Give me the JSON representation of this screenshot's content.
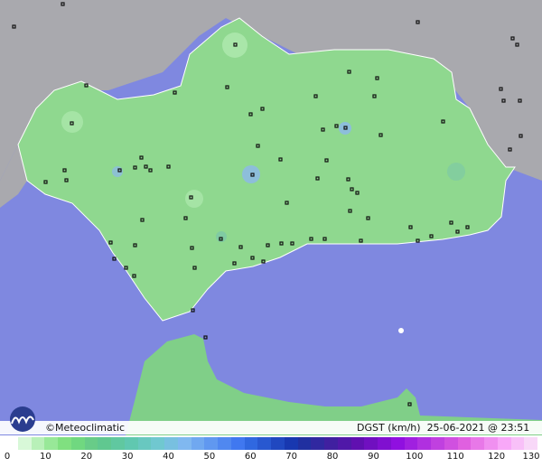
{
  "credit": "©Meteoclimatic",
  "variable": "DGST",
  "unit": "(km/h)",
  "date": "25-06-2021",
  "at": "@",
  "time": "23:51 UTC",
  "colors": {
    "sea": "#7f88e0",
    "land_outside": "#a8a8ac",
    "andalusia": "#8fd88f",
    "border": "#ffffff",
    "station": "#111111"
  },
  "legend": {
    "ticks": [
      "0",
      "10",
      "20",
      "30",
      "40",
      "50",
      "60",
      "70",
      "80",
      "90",
      "100",
      "110",
      "120",
      "130"
    ],
    "colors": [
      "#ffffff",
      "#d8f8d8",
      "#b8f0b8",
      "#98e898",
      "#80e080",
      "#70d880",
      "#68cc88",
      "#60c890",
      "#60c8a0",
      "#60c8b0",
      "#68c8c0",
      "#70c8d0",
      "#78c0e0",
      "#80b8f0",
      "#70a8f0",
      "#6098f0",
      "#5088f0",
      "#4078f0",
      "#3068e0",
      "#2858d0",
      "#2048c0",
      "#1838b0",
      "#2030a0",
      "#3028a0",
      "#4020a0",
      "#5018a8",
      "#6010b0",
      "#7010c0",
      "#8010d0",
      "#9010e0",
      "#a020e0",
      "#b030e0",
      "#c040e0",
      "#d050e0",
      "#e060e0",
      "#e878e8",
      "#f090f0",
      "#f8a8f8",
      "#f8c0f8",
      "#f8d8f8"
    ]
  }
}
